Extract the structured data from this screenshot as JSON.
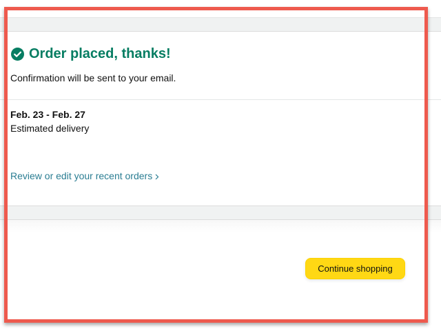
{
  "confirmation": {
    "icon": "check-circle-icon",
    "title": "Order placed, thanks!",
    "subtitle": "Confirmation will be sent to your email.",
    "accent_color": "#067d62"
  },
  "delivery": {
    "date_range": "Feb. 23 - Feb. 27",
    "label": "Estimated delivery"
  },
  "links": {
    "review_orders": "Review or edit your recent orders",
    "review_orders_icon": "chevron-right-icon",
    "link_color": "#2a7d92"
  },
  "actions": {
    "continue_shopping": "Continue shopping",
    "button_color": "#ffd814"
  },
  "annotation": {
    "highlight_color": "#ee5a4e"
  }
}
